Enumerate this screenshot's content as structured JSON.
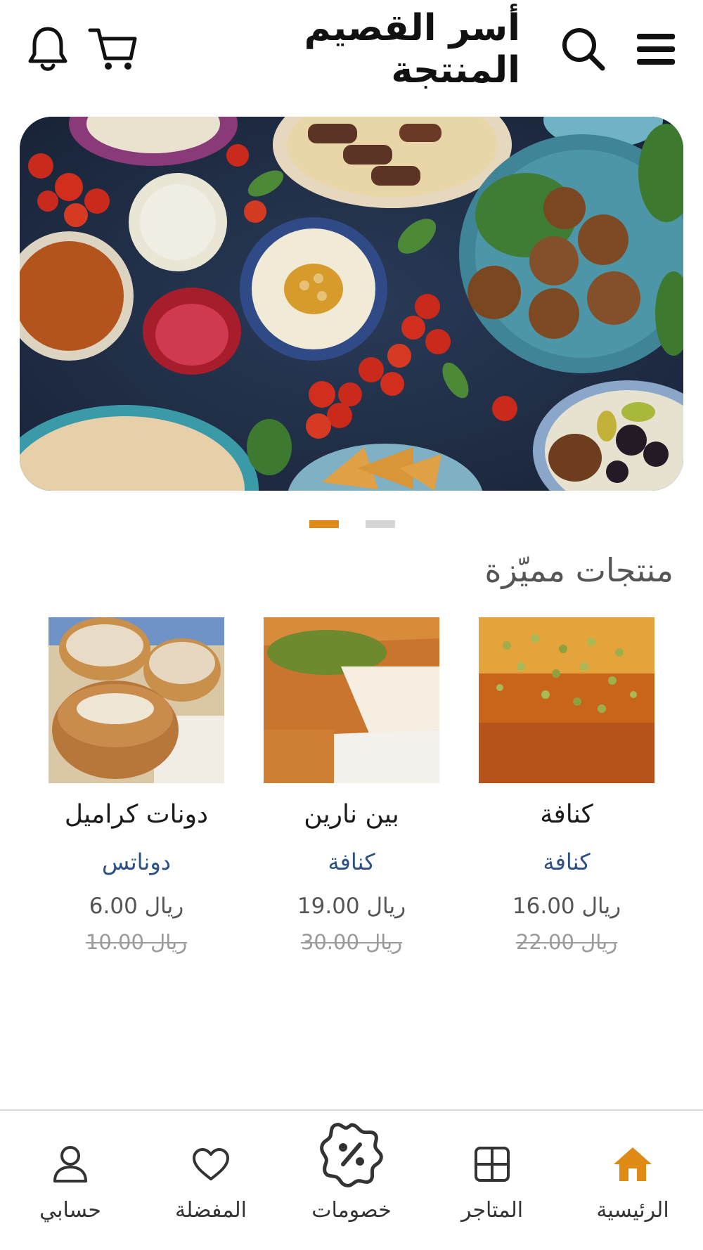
{
  "header": {
    "title": "أسر القصيم المنتجة",
    "icons": [
      "menu-icon",
      "search-icon",
      "cart-icon",
      "bell-icon"
    ]
  },
  "banner": {
    "slides_count": 2,
    "active_slide": 1
  },
  "colors": {
    "accent": "#e08a16",
    "category": "#2c4f86",
    "inactive_dot": "#d6d6d6"
  },
  "featured": {
    "title": "منتجات مميّزة",
    "products": [
      {
        "name": "كنافة",
        "category": "كنافة",
        "price": "ريال 16.00",
        "old_price": "ريال 22.00"
      },
      {
        "name": "بين نارين",
        "category": "كنافة",
        "price": "ريال 19.00",
        "old_price": "ريال 30.00"
      },
      {
        "name": "دونات كراميل",
        "category": "دوناتس",
        "price": "ريال 6.00",
        "old_price": "ريال 10.00"
      }
    ]
  },
  "bottom_nav": {
    "items": [
      {
        "label": "الرئيسية",
        "icon": "home-icon",
        "active": true
      },
      {
        "label": "المتاجر",
        "icon": "stores-grid-icon",
        "active": false
      },
      {
        "label": "خصومات",
        "icon": "discount-badge-icon",
        "active": false
      },
      {
        "label": "المفضلة",
        "icon": "heart-icon",
        "active": false
      },
      {
        "label": "حسابي",
        "icon": "user-icon",
        "active": false
      }
    ]
  }
}
